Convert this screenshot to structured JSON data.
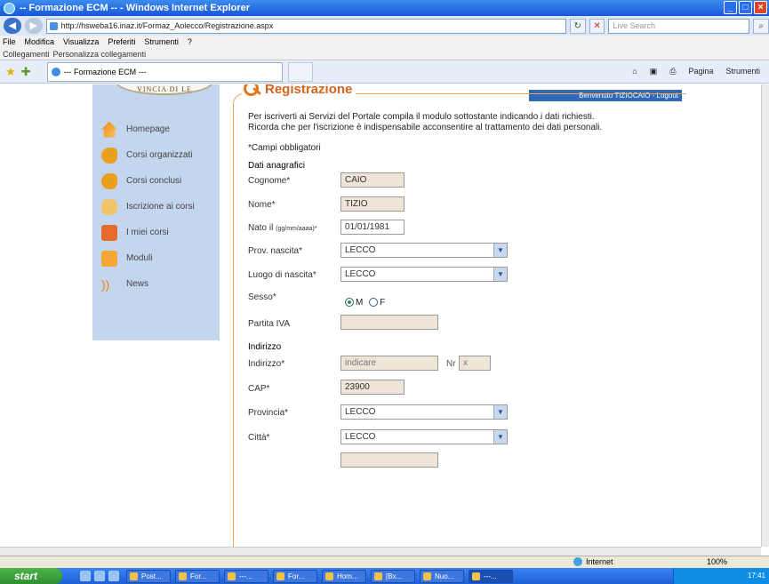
{
  "window": {
    "title": "-- Formazione ECM -- - Windows Internet Explorer"
  },
  "toolbar": {
    "address": "http://hsweba16.inaz.it/Formaz_Aolecco/Registrazione.aspx",
    "search_placeholder": "Live Search",
    "menu": [
      "File",
      "Modifica",
      "Visualizza",
      "Preferiti",
      "Strumenti",
      "?"
    ],
    "links_label": "Collegamenti",
    "links_item": "Personalizza collegamenti",
    "tab_title": "--- Formazione ECM ---",
    "cmd": [
      "Pagina",
      "Strumenti"
    ]
  },
  "site": {
    "logo_text": "VINCIA DI LE",
    "welcome": "Benvenuto TIZIOCAIO - Logout",
    "nav": [
      {
        "label": "Homepage",
        "icon": "home-icon"
      },
      {
        "label": "Corsi organizzati",
        "icon": "people-icon"
      },
      {
        "label": "Corsi conclusi",
        "icon": "people-icon"
      },
      {
        "label": "Iscrizione ai corsi",
        "icon": "hand-icon"
      },
      {
        "label": "I miei corsi",
        "icon": "courses-icon"
      },
      {
        "label": "Moduli",
        "icon": "form-icon"
      },
      {
        "label": "News",
        "icon": "rss-icon"
      }
    ]
  },
  "form": {
    "title": "Registrazione",
    "intro1": "Per iscriverti ai Servizi del Portale compila il modulo sottostante indicando i dati richiesti.",
    "intro2": "Ricorda che per l'iscrizione è indispensabile acconsentire al trattamento dei dati personali.",
    "required_note": "*Campi obbligatori",
    "section_personal": "Dati anagrafici",
    "cognome_label": "Cognome*",
    "cognome_value": "CAIO",
    "nome_label": "Nome*",
    "nome_value": "TIZIO",
    "nato_label": "Nato il",
    "nato_hint": "(gg/mm/aaaa)*",
    "nato_value": "01/01/1981",
    "prov_label": "Prov. nascita*",
    "prov_value": "LECCO",
    "luogo_label": "Luogo di nascita*",
    "luogo_value": "LECCO",
    "sesso_label": "Sesso*",
    "sesso_m": "M",
    "sesso_f": "F",
    "iva_label": "Partita IVA",
    "iva_value": "",
    "section_address": "Indirizzo",
    "indirizzo_label": "Indirizzo*",
    "indirizzo_value": "indicare",
    "nr_label": "Nr",
    "nr_value": "x",
    "cap_label": "CAP*",
    "cap_value": "23900",
    "provincia_label": "Provincia*",
    "provincia_value": "LECCO",
    "citta_label": "Città*",
    "citta_value": "LECCO"
  },
  "status": {
    "zone": "Internet",
    "zoom": "100%"
  },
  "taskbar": {
    "start": "start",
    "buttons": [
      "Post...",
      "For...",
      "---...",
      "For...",
      "Hom...",
      "[Bx...",
      "Nuo...",
      "---..."
    ],
    "clock": "17:41"
  }
}
